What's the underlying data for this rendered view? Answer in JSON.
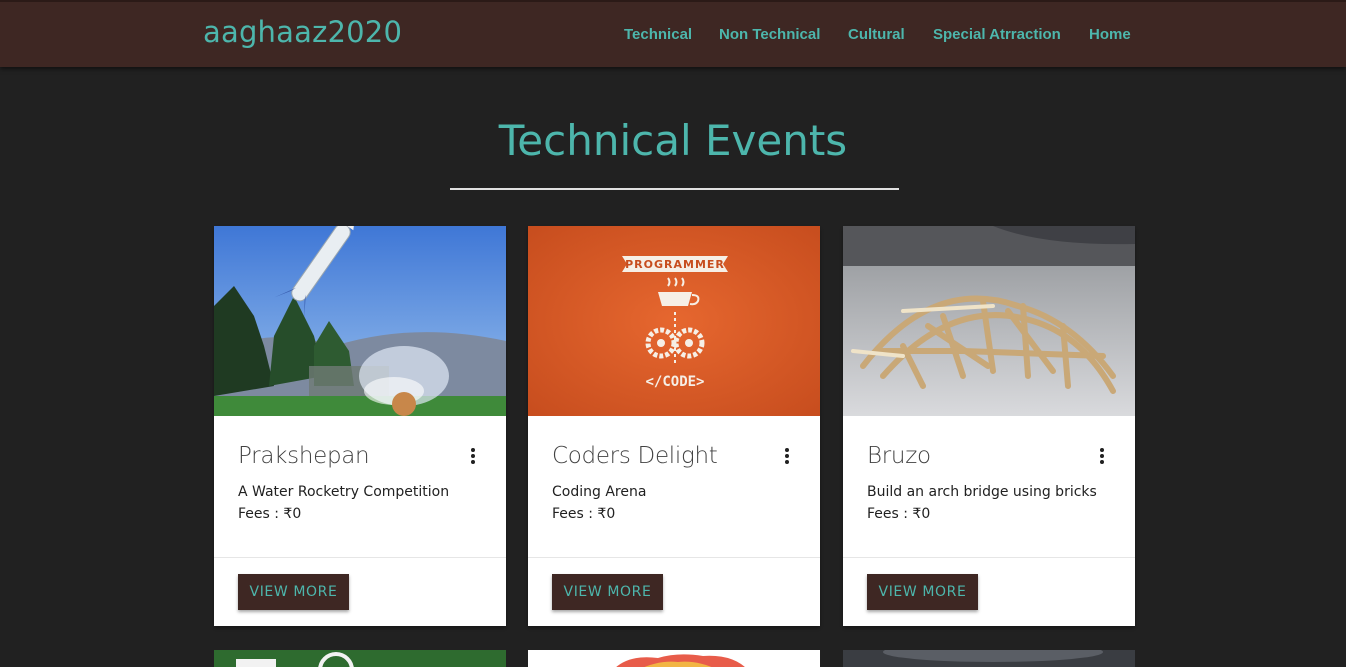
{
  "header": {
    "brand": "aaghaaz2020",
    "nav": [
      "Technical",
      "Non Technical",
      "Cultural",
      "Special Atrraction",
      "Home"
    ]
  },
  "page": {
    "title": "Technical Events"
  },
  "events": [
    {
      "title": "Prakshepan",
      "description": "A Water Rocketry Competition",
      "fees": "Fees : ₹0",
      "button": "VIEW MORE"
    },
    {
      "title": "Coders Delight",
      "description": "Coding Arena",
      "fees": "Fees : ₹0",
      "button": "VIEW MORE"
    },
    {
      "title": "Bruzo",
      "description": "Build an arch bridge using bricks",
      "fees": "Fees : ₹0",
      "button": "VIEW MORE"
    }
  ],
  "programmer_poster": {
    "banner": "PROGRAMMER",
    "code": "</CODE>"
  },
  "colors": {
    "accent": "#4db6ac",
    "navbar": "#3e2723",
    "background": "#212121",
    "button": "#3e2723"
  },
  "icons": [
    "more-vert-icon"
  ]
}
